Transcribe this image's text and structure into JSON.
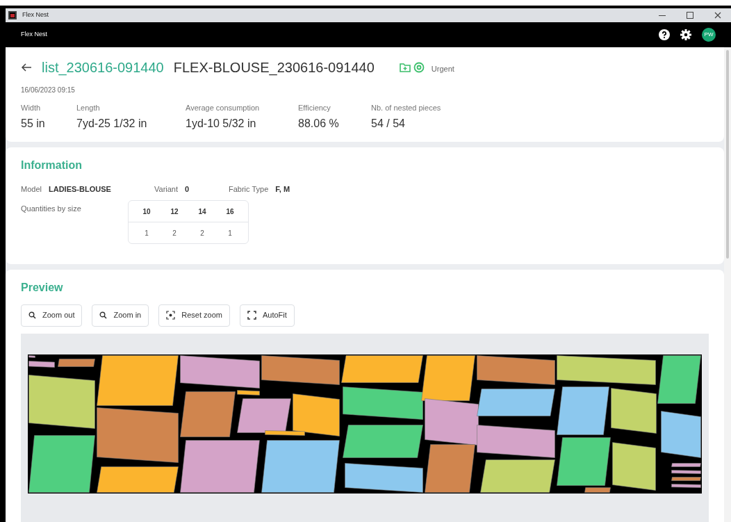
{
  "window": {
    "title": "Flex Nest"
  },
  "app_bar": {
    "title": "Flex Nest",
    "avatar": "PW"
  },
  "header": {
    "list_name": "list_230616-091440",
    "nest_name": "FLEX-BLOUSE_230616-091440",
    "priority": "Urgent",
    "date": "16/06/2023 09:15",
    "stats": [
      {
        "label": "Width",
        "value": "55 in"
      },
      {
        "label": "Length",
        "value": "7yd-25 1/32 in"
      },
      {
        "label": "Average consumption",
        "value": "1yd-10 5/32 in"
      },
      {
        "label": "Efficiency",
        "value": "88.06 %"
      },
      {
        "label": "Nb. of nested pieces",
        "value": "54 / 54"
      }
    ]
  },
  "information": {
    "title": "Information",
    "fields": [
      {
        "label": "Model",
        "value": "LADIES-BLOUSE"
      },
      {
        "label": "Variant",
        "value": "0"
      },
      {
        "label": "Fabric Type",
        "value": "F, M"
      }
    ],
    "quantities_label": "Quantities by size",
    "sizes": [
      "10",
      "12",
      "14",
      "16"
    ],
    "quantities": [
      "1",
      "2",
      "2",
      "1"
    ]
  },
  "preview": {
    "title": "Preview",
    "buttons": [
      "Zoom out",
      "Zoom in",
      "Reset zoom",
      "AutoFit"
    ]
  }
}
